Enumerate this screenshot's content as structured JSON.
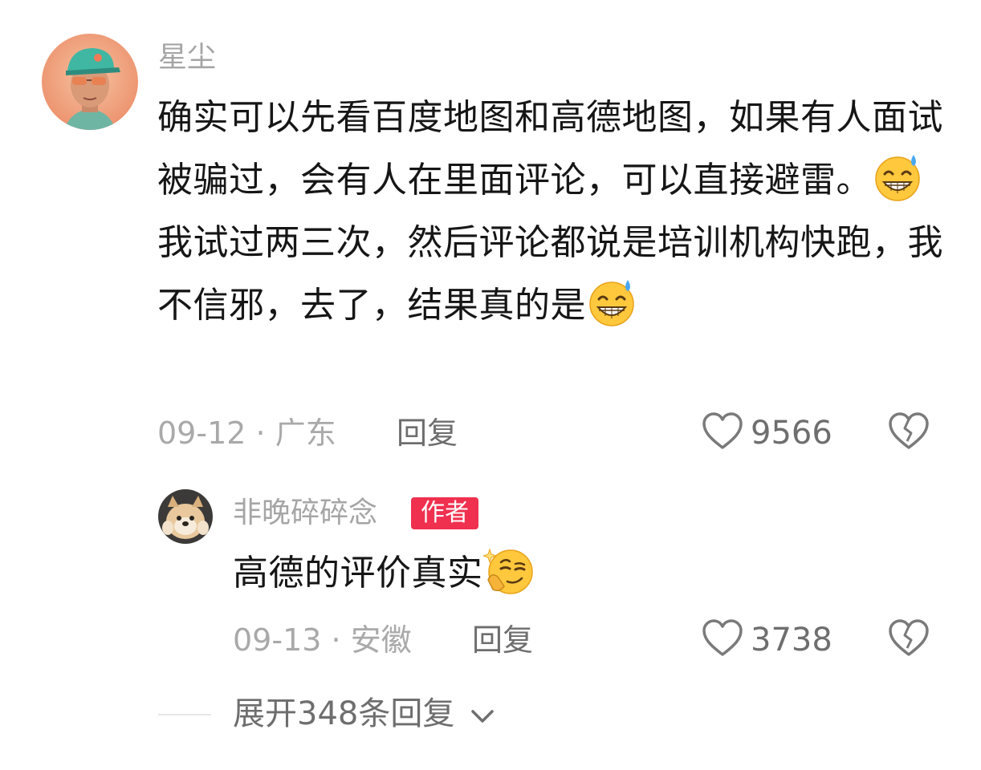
{
  "comment": {
    "username": "星尘",
    "text_parts": [
      "确实可以先看百度地图和高德地图，如果有人面试被骗过，会有人在里面评论，可以直接避雷。",
      "我试过两三次，然后评论都说是培训机构快跑，我不信邪，去了，结果真的是"
    ],
    "emoji_icons": [
      "grinning-sweat-emoji-icon",
      "grinning-sweat-emoji-icon"
    ],
    "date": "09-12",
    "separator": "·",
    "location": "广东",
    "reply_label": "回复",
    "like_count": "9566"
  },
  "reply": {
    "username": "非晚碎碎念",
    "badge": "作者",
    "text": "高德的评价真实",
    "emoji_icon": "thinking-sly-emoji-icon",
    "date": "09-13",
    "separator": "·",
    "location": "安徽",
    "reply_label": "回复",
    "like_count": "3738"
  },
  "expand": {
    "label": "展开348条回复"
  },
  "colors": {
    "badge_bg": "#f0304f",
    "muted_text": "#a9a9a9",
    "secondary_text": "#6e6e6e",
    "primary_text": "#161616"
  }
}
